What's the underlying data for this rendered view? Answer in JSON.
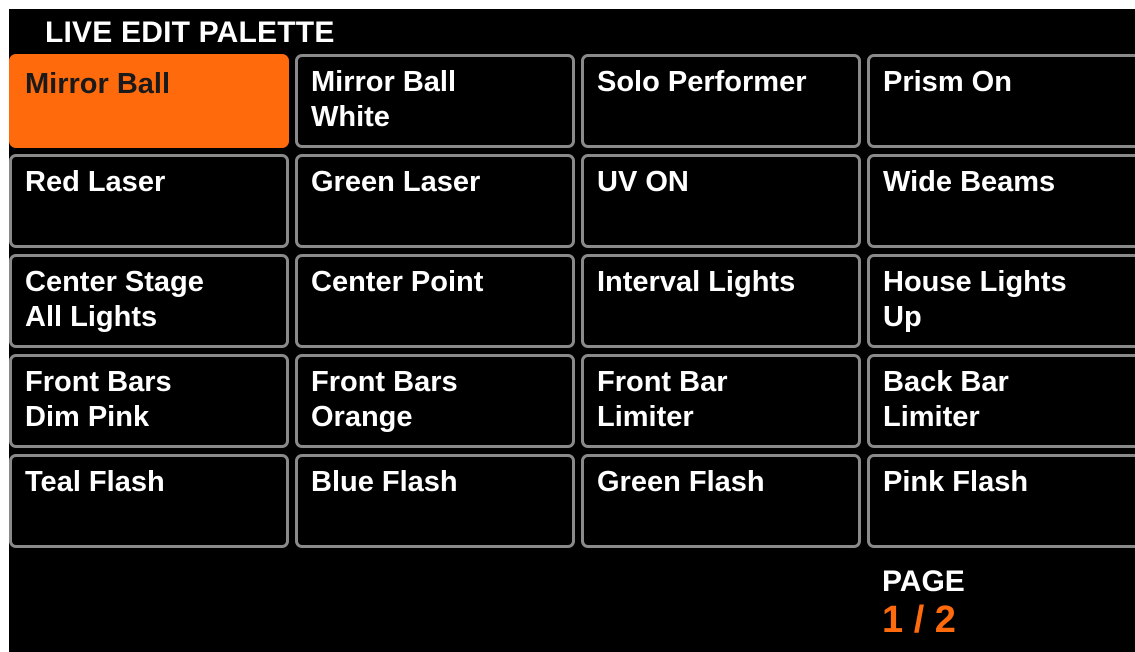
{
  "title": "LIVE EDIT PALETTE",
  "colors": {
    "background": "#000000",
    "cell_border": "#8a8a8a",
    "active_fill": "#ff6a0d",
    "accent": "#ff6a0d",
    "text": "#ffffff"
  },
  "cells": [
    {
      "label": "Mirror Ball",
      "active": true
    },
    {
      "label": "Mirror Ball\nWhite",
      "active": false
    },
    {
      "label": "Solo Performer",
      "active": false
    },
    {
      "label": "Prism On",
      "active": false
    },
    {
      "label": "Red Laser",
      "active": false
    },
    {
      "label": "Green Laser",
      "active": false
    },
    {
      "label": "UV ON",
      "active": false
    },
    {
      "label": "Wide Beams",
      "active": false
    },
    {
      "label": "Center Stage\nAll Lights",
      "active": false
    },
    {
      "label": "Center Point",
      "active": false
    },
    {
      "label": "Interval Lights",
      "active": false
    },
    {
      "label": "House Lights\nUp",
      "active": false
    },
    {
      "label": "Front Bars\nDim Pink",
      "active": false
    },
    {
      "label": "Front Bars\nOrange",
      "active": false
    },
    {
      "label": "Front Bar\nLimiter",
      "active": false
    },
    {
      "label": "Back Bar\nLimiter",
      "active": false
    },
    {
      "label": "Teal Flash",
      "active": false
    },
    {
      "label": "Blue Flash",
      "active": false
    },
    {
      "label": "Green Flash",
      "active": false
    },
    {
      "label": "Pink Flash",
      "active": false
    }
  ],
  "page": {
    "label": "PAGE",
    "value": "1 / 2"
  }
}
